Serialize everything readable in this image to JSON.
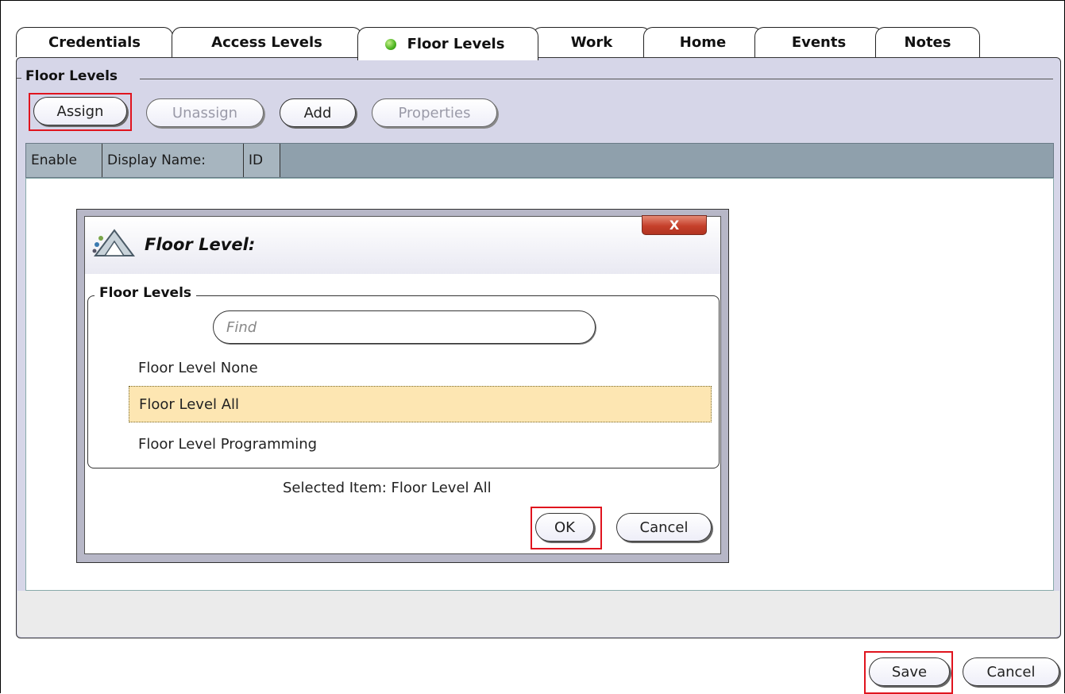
{
  "tabs": [
    {
      "label": "Credentials",
      "active": false
    },
    {
      "label": "Access Levels",
      "active": false
    },
    {
      "label": "Floor Levels",
      "active": true
    },
    {
      "label": "Work",
      "active": false
    },
    {
      "label": "Home",
      "active": false
    },
    {
      "label": "Events",
      "active": false
    },
    {
      "label": "Notes",
      "active": false
    }
  ],
  "panel": {
    "legend": "Floor Levels",
    "toolbar": {
      "assign": "Assign",
      "unassign": "Unassign",
      "add": "Add",
      "properties": "Properties"
    },
    "grid_columns": [
      "Enable",
      "Display Name:",
      "ID"
    ]
  },
  "dialog": {
    "title": "Floor Level:",
    "close_label": "X",
    "group_legend": "Floor Levels",
    "find_placeholder": "Find",
    "items": [
      "Floor Level None",
      "Floor Level All",
      "Floor Level Programming"
    ],
    "selected_index": 1,
    "selected_text": "Selected Item: Floor Level All",
    "ok": "OK",
    "cancel": "Cancel"
  },
  "footer": {
    "save": "Save",
    "cancel": "Cancel"
  },
  "colors": {
    "active_tab_indicator": "#4bb320",
    "highlight_box": "#e0141e",
    "selected_row": "#fde6b2",
    "panel_bg": "#d6d6e8",
    "grid_header": "#8fa0ac"
  },
  "icons": {
    "tab_status": "green-dot-icon",
    "dialog_logo": "app-logo-icon",
    "close": "close-icon"
  }
}
